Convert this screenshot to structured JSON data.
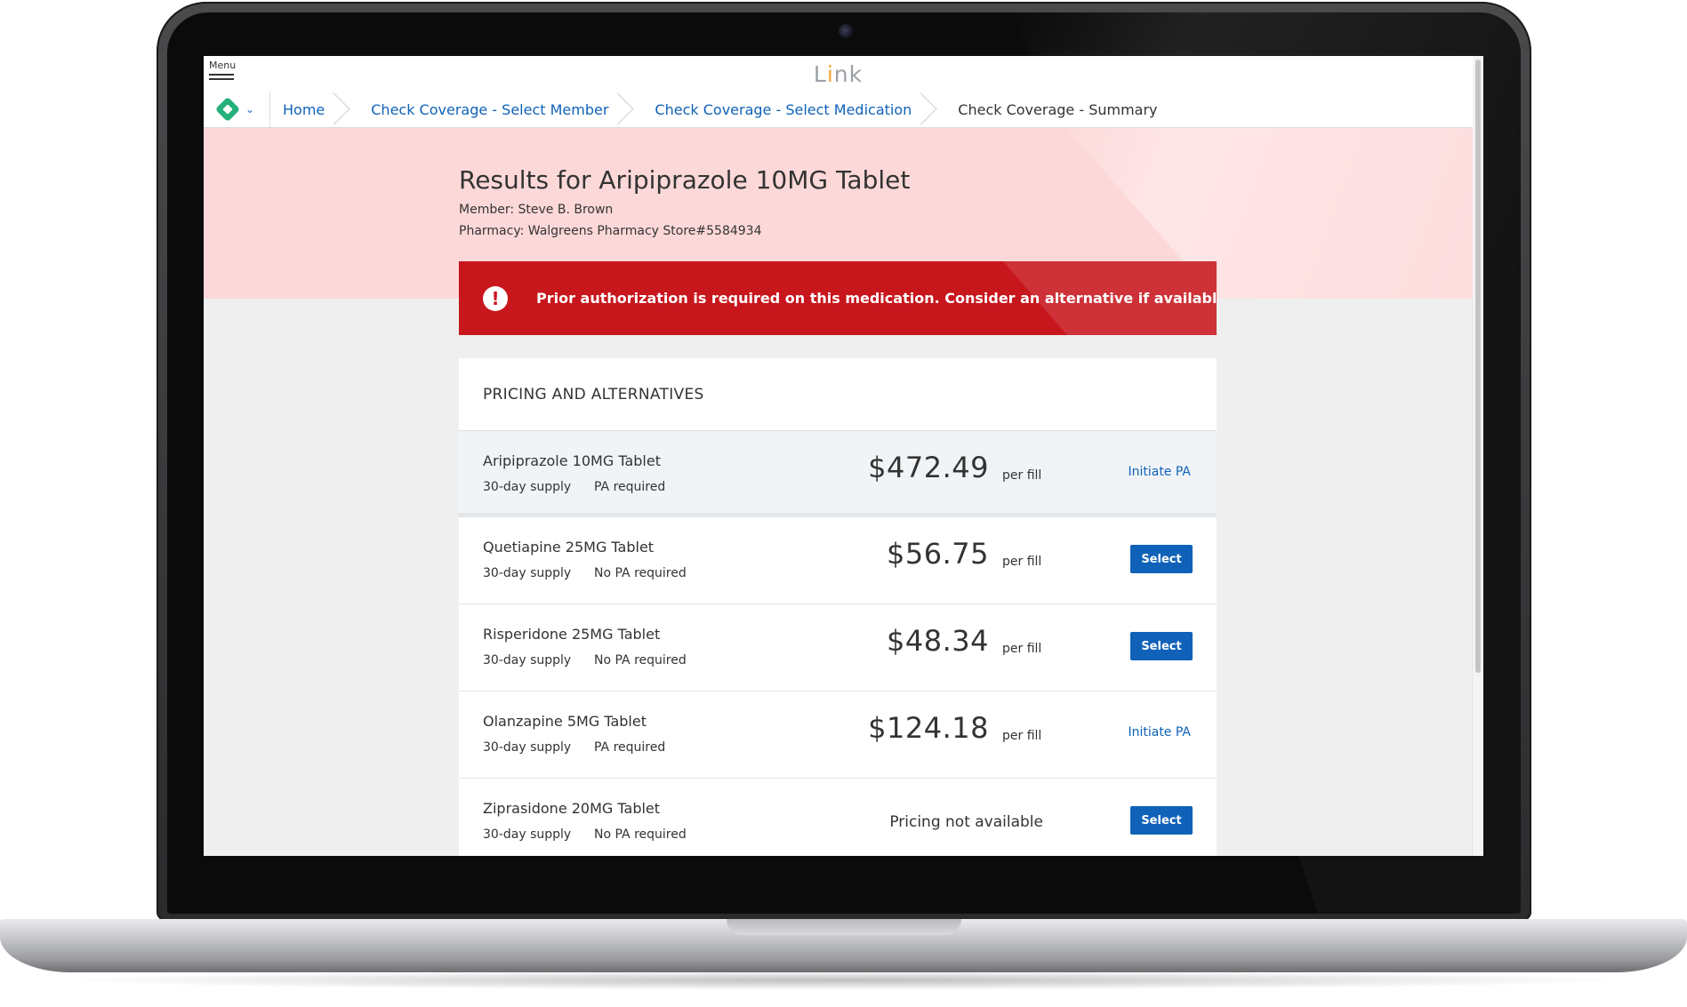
{
  "app": {
    "title_pre": "L",
    "title_dot": "i",
    "title_post": "nk",
    "menu_label": "Menu"
  },
  "breadcrumb": [
    {
      "label": "Home"
    },
    {
      "label": "Check Coverage - Select Member"
    },
    {
      "label": "Check Coverage - Select Medication"
    },
    {
      "label": "Check Coverage - Summary"
    }
  ],
  "results": {
    "title": "Results for Aripiprazole 10MG Tablet",
    "member": "Member: Steve B. Brown",
    "pharmacy": "Pharmacy: Walgreens Pharmacy Store#5584934"
  },
  "alert": {
    "icon": "exclamation-icon",
    "text": "Prior authorization is required on this medication. Consider an alternative if available."
  },
  "pricing": {
    "header": "PRICING AND ALTERNATIVES",
    "per_fill_label": "per fill",
    "rows": [
      {
        "name": "Aripiprazole 10MG Tablet",
        "supply": "30-day supply",
        "pa": "PA required",
        "price": "$472.49",
        "action": "Initiate PA"
      },
      {
        "name": "Quetiapine 25MG Tablet",
        "supply": "30-day supply",
        "pa": "No PA required",
        "price": "$56.75",
        "action": "Select"
      },
      {
        "name": "Risperidone 25MG Tablet",
        "supply": "30-day supply",
        "pa": "No PA required",
        "price": "$48.34",
        "action": "Select"
      },
      {
        "name": "Olanzapine 5MG Tablet",
        "supply": "30-day supply",
        "pa": "PA required",
        "price": "$124.18",
        "action": "Initiate PA"
      },
      {
        "name": "Ziprasidone 20MG Tablet",
        "supply": "30-day supply",
        "pa": "No PA required",
        "price": "Pricing not available",
        "action": "Select"
      }
    ]
  },
  "colors": {
    "accent": "#0f62b8",
    "alert_bg": "#c8161d",
    "hero_bg": "#fdd8d9",
    "logo": "#25b07a"
  }
}
